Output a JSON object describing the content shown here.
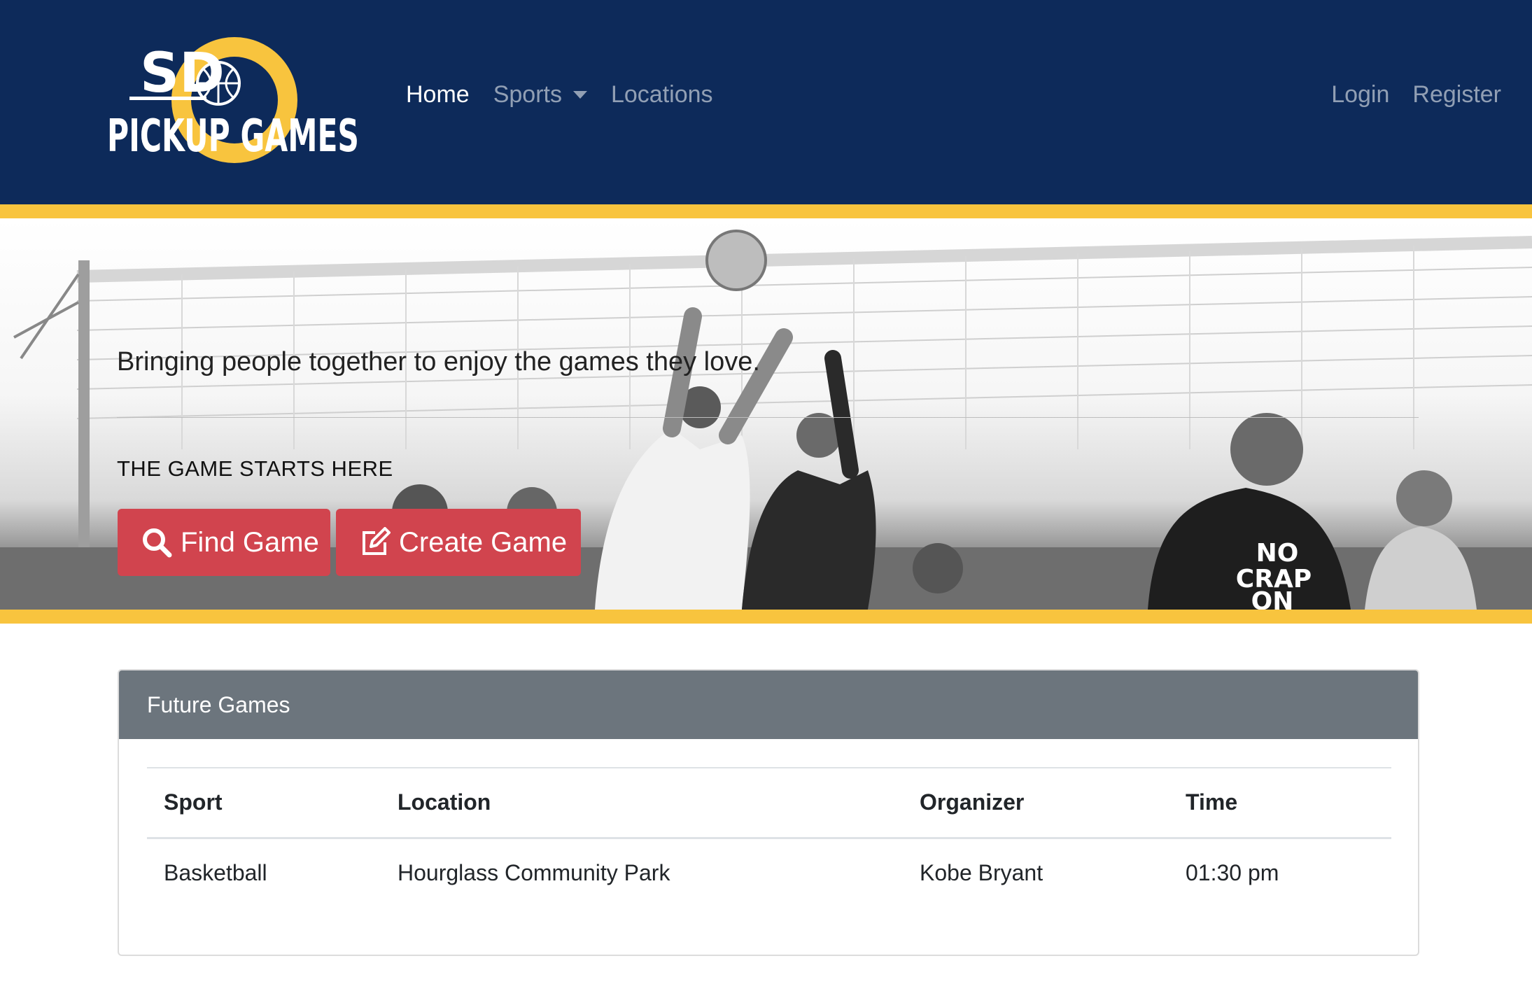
{
  "logo": {
    "line1": "SD",
    "line2": "PICKUP GAMES"
  },
  "nav": {
    "home": "Home",
    "sports": "Sports",
    "locations": "Locations",
    "login": "Login",
    "register": "Register"
  },
  "hero": {
    "tagline": "Bringing people together to enjoy the games they love.",
    "kicker": "THE GAME STARTS HERE",
    "find_button": "Find Game",
    "create_button": "Create Game",
    "shirt_text": [
      "NO",
      "CRAP",
      "ON"
    ]
  },
  "colors": {
    "navbar": "#0d2a5a",
    "gold": "#f8c43e",
    "button": "#d1444e",
    "card_header": "#6c757d"
  },
  "future_games": {
    "title": "Future Games",
    "columns": [
      "Sport",
      "Location",
      "Organizer",
      "Time"
    ],
    "rows": [
      [
        "Basketball",
        "Hourglass Community Park",
        "Kobe Bryant",
        "01:30 pm"
      ]
    ]
  }
}
